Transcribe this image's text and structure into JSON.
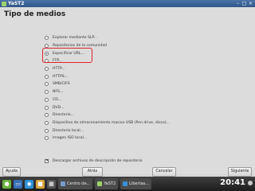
{
  "window": {
    "title": "YaST2"
  },
  "page": {
    "title": "Tipo de medios"
  },
  "options": [
    {
      "label": "Explorar mediante SLP...",
      "selected": false
    },
    {
      "label": "Repositorios de la comunidad",
      "selected": false
    },
    {
      "label": "Especificar URL...",
      "selected": true
    },
    {
      "label": "FTP...",
      "selected": false
    },
    {
      "label": "HTTP...",
      "selected": false
    },
    {
      "label": "HTTPS...",
      "selected": false
    },
    {
      "label": "SMB/CIFS",
      "selected": false
    },
    {
      "label": "NFS...",
      "selected": false
    },
    {
      "label": "CD...",
      "selected": false
    },
    {
      "label": "DVD...",
      "selected": false
    },
    {
      "label": "Directorio...",
      "selected": false
    },
    {
      "label": "Dispositivo de almacenamiento masivo USB (Pen drive, disco)...",
      "selected": false
    },
    {
      "label": "Directorio local...",
      "selected": false
    },
    {
      "label": "Imagen ISO local...",
      "selected": false
    }
  ],
  "download_checkbox": {
    "label": "Descargar archivos de descripción de repositorio",
    "checked": true
  },
  "buttons": {
    "help": "Ayuda",
    "back": "Atrás",
    "cancel": "Cancelar",
    "next": "Siguiente"
  },
  "taskbar": {
    "tasks": [
      "Centro de...",
      "YaST2",
      "Libertas..."
    ],
    "clock": "20:41"
  },
  "colors": {
    "highlight": "#e0222a",
    "titlebar": "#2f5688"
  }
}
